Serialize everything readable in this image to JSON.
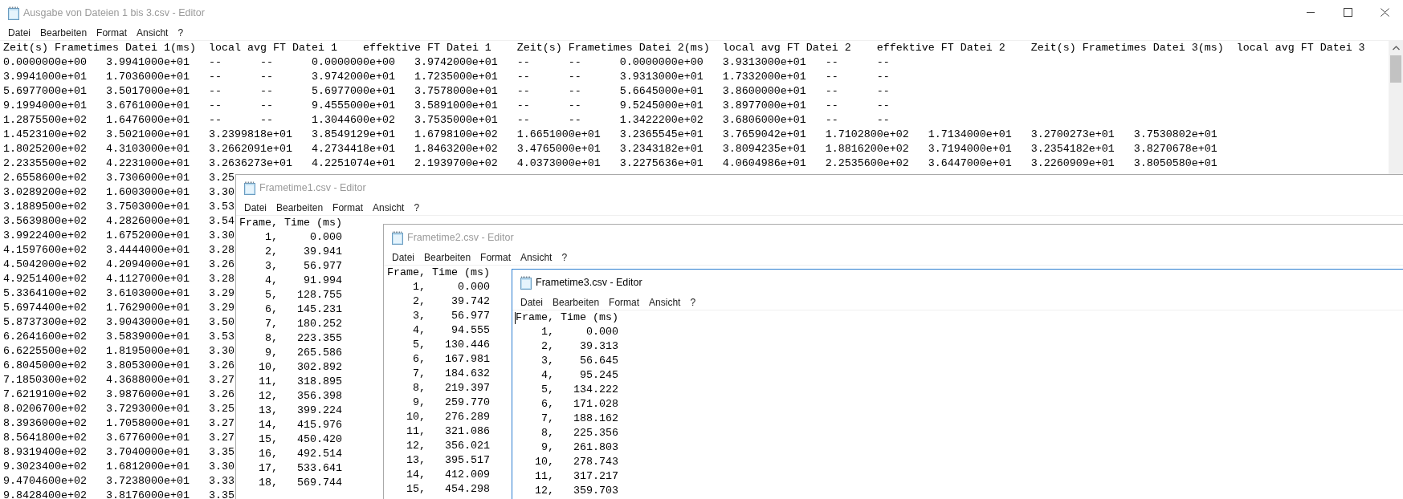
{
  "windows": [
    {
      "title": "Ausgabe von Dateien 1 bis 3.csv - Editor",
      "kind": "text",
      "active": false,
      "cursor": false,
      "menu": [
        "Datei",
        "Bearbeiten",
        "Format",
        "Ansicht",
        "?"
      ],
      "lines": [
        "Zeit(s) Frametimes Datei 1(ms)\tlocal avg FT Datei 1\teffektive FT Datei 1\tZeit(s) Frametimes Datei 2(ms)\tlocal avg FT Datei 2\teffektive FT Datei 2\tZeit(s) Frametimes Datei 3(ms)\tlocal avg FT Datei 3",
        "0.0000000e+00\t3.9941000e+01\t--\t--\t0.0000000e+00\t3.9742000e+01\t--\t--\t0.0000000e+00\t3.9313000e+01\t--\t--",
        "3.9941000e+01\t1.7036000e+01\t--\t--\t3.9742000e+01\t1.7235000e+01\t--\t--\t3.9313000e+01\t1.7332000e+01\t--\t--",
        "5.6977000e+01\t3.5017000e+01\t--\t--\t5.6977000e+01\t3.7578000e+01\t--\t--\t5.6645000e+01\t3.8600000e+01\t--\t--",
        "9.1994000e+01\t3.6761000e+01\t--\t--\t9.4555000e+01\t3.5891000e+01\t--\t--\t9.5245000e+01\t3.8977000e+01\t--\t--",
        "1.2875500e+02\t1.6476000e+01\t--\t--\t1.3044600e+02\t3.7535000e+01\t--\t--\t1.3422200e+02\t3.6806000e+01\t--\t--",
        "1.4523100e+02\t3.5021000e+01\t3.2399818e+01\t3.8549129e+01\t1.6798100e+02\t1.6651000e+01\t3.2365545e+01\t3.7659042e+01\t1.7102800e+02\t1.7134000e+01\t3.2700273e+01\t3.7530802e+01",
        "1.8025200e+02\t4.3103000e+01\t3.2662091e+01\t4.2734418e+01\t1.8463200e+02\t3.4765000e+01\t3.2343182e+01\t3.8094235e+01\t1.8816200e+02\t3.7194000e+01\t3.2354182e+01\t3.8270678e+01",
        "2.2335500e+02\t4.2231000e+01\t3.2636273e+01\t4.2251074e+01\t2.1939700e+02\t4.0373000e+01\t3.2275636e+01\t4.0604986e+01\t2.2535600e+02\t3.6447000e+01\t3.2260909e+01\t3.8050580e+01",
        "2.6558600e+02\t3.7306000e+01\t3.25",
        "3.0289200e+02\t1.6003000e+01\t3.30",
        "3.1889500e+02\t3.7503000e+01\t3.53",
        "3.5639800e+02\t4.2826000e+01\t3.54",
        "3.9922400e+02\t1.6752000e+01\t3.30",
        "4.1597600e+02\t3.4444000e+01\t3.28",
        "4.5042000e+02\t4.2094000e+01\t3.26",
        "4.9251400e+02\t4.1127000e+01\t3.28",
        "5.3364100e+02\t3.6103000e+01\t3.29",
        "5.6974400e+02\t1.7629000e+01\t3.29",
        "5.8737300e+02\t3.9043000e+01\t3.50",
        "6.2641600e+02\t3.5839000e+01\t3.53",
        "6.6225500e+02\t1.8195000e+01\t3.30",
        "6.8045000e+02\t3.8053000e+01\t3.26",
        "7.1850300e+02\t4.3688000e+01\t3.27",
        "7.6219100e+02\t3.9876000e+01\t3.26",
        "8.0206700e+02\t3.7293000e+01\t3.25",
        "8.3936000e+02\t1.7058000e+01\t3.27",
        "8.5641800e+02\t3.6776000e+01\t3.27",
        "8.9319400e+02\t3.7040000e+01\t3.35",
        "9.3023400e+02\t1.6812000e+01\t3.30",
        "9.4704600e+02\t3.7238000e+01\t3.33",
        "9.8428400e+02\t3.8176000e+01\t3.35"
      ]
    },
    {
      "title": "Frametime1.csv - Editor",
      "kind": "frames",
      "active": false,
      "cursor": false,
      "menu": [
        "Datei",
        "Bearbeiten",
        "Format",
        "Ansicht",
        "?"
      ],
      "header": "Frame, Time (ms)",
      "rows": [
        {
          "frame": "1,",
          "time": "0.000"
        },
        {
          "frame": "2,",
          "time": "39.941"
        },
        {
          "frame": "3,",
          "time": "56.977"
        },
        {
          "frame": "4,",
          "time": "91.994"
        },
        {
          "frame": "5,",
          "time": "128.755"
        },
        {
          "frame": "6,",
          "time": "145.231"
        },
        {
          "frame": "7,",
          "time": "180.252"
        },
        {
          "frame": "8,",
          "time": "223.355"
        },
        {
          "frame": "9,",
          "time": "265.586"
        },
        {
          "frame": "10,",
          "time": "302.892"
        },
        {
          "frame": "11,",
          "time": "318.895"
        },
        {
          "frame": "12,",
          "time": "356.398"
        },
        {
          "frame": "13,",
          "time": "399.224"
        },
        {
          "frame": "14,",
          "time": "415.976"
        },
        {
          "frame": "15,",
          "time": "450.420"
        },
        {
          "frame": "16,",
          "time": "492.514"
        },
        {
          "frame": "17,",
          "time": "533.641"
        },
        {
          "frame": "18,",
          "time": "569.744"
        }
      ]
    },
    {
      "title": "Frametime2.csv - Editor",
      "kind": "frames",
      "active": false,
      "cursor": false,
      "menu": [
        "Datei",
        "Bearbeiten",
        "Format",
        "Ansicht",
        "?"
      ],
      "header": "Frame, Time (ms)",
      "rows": [
        {
          "frame": "1,",
          "time": "0.000"
        },
        {
          "frame": "2,",
          "time": "39.742"
        },
        {
          "frame": "3,",
          "time": "56.977"
        },
        {
          "frame": "4,",
          "time": "94.555"
        },
        {
          "frame": "5,",
          "time": "130.446"
        },
        {
          "frame": "6,",
          "time": "167.981"
        },
        {
          "frame": "7,",
          "time": "184.632"
        },
        {
          "frame": "8,",
          "time": "219.397"
        },
        {
          "frame": "9,",
          "time": "259.770"
        },
        {
          "frame": "10,",
          "time": "276.289"
        },
        {
          "frame": "11,",
          "time": "321.086"
        },
        {
          "frame": "12,",
          "time": "356.021"
        },
        {
          "frame": "13,",
          "time": "395.517"
        },
        {
          "frame": "14,",
          "time": "412.009"
        },
        {
          "frame": "15,",
          "time": "454.298"
        }
      ]
    },
    {
      "title": "Frametime3.csv - Editor",
      "kind": "frames",
      "active": true,
      "cursor": true,
      "menu": [
        "Datei",
        "Bearbeiten",
        "Format",
        "Ansicht",
        "?"
      ],
      "header": "Frame, Time (ms)",
      "rows": [
        {
          "frame": "1,",
          "time": "0.000"
        },
        {
          "frame": "2,",
          "time": "39.313"
        },
        {
          "frame": "3,",
          "time": "56.645"
        },
        {
          "frame": "4,",
          "time": "95.245"
        },
        {
          "frame": "5,",
          "time": "134.222"
        },
        {
          "frame": "6,",
          "time": "171.028"
        },
        {
          "frame": "7,",
          "time": "188.162"
        },
        {
          "frame": "8,",
          "time": "225.356"
        },
        {
          "frame": "9,",
          "time": "261.803"
        },
        {
          "frame": "10,",
          "time": "278.743"
        },
        {
          "frame": "11,",
          "time": "317.217"
        },
        {
          "frame": "12,",
          "time": "359.703"
        }
      ]
    }
  ]
}
